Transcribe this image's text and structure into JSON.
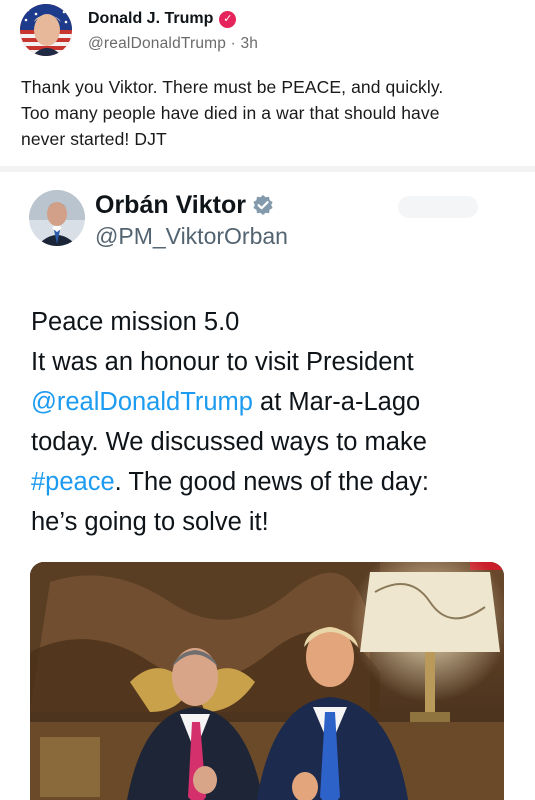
{
  "post": {
    "author_name": "Donald J. Trump",
    "handle": "@realDonaldTrump",
    "separator": " · ",
    "time": "3h",
    "body_line1": "Thank you Viktor. There must be PEACE, and quickly.",
    "body_line2": "Too many people have died in a war that should have",
    "body_line3": "never started! DJT"
  },
  "embedded": {
    "author_name": "Orbán Viktor",
    "handle": "@PM_ViktorOrban",
    "line1": "Peace mission 5.0",
    "line2": "It was an honour to visit President",
    "line3_mention": "@realDonaldTrump",
    "line3_rest": " at Mar-a-Lago",
    "line4": "today. We discussed ways to make",
    "line5_hashtag": "#peace",
    "line5_rest": ". The good news of the day:",
    "line6": "he’s going to solve it!"
  },
  "colors": {
    "truth_verified": "#e4245b",
    "x_verified": "#829aab",
    "link": "#1d9bf0"
  },
  "icons": {
    "truth_verified": "verified-badge-icon",
    "x_verified": "verified-checkmark-icon"
  }
}
